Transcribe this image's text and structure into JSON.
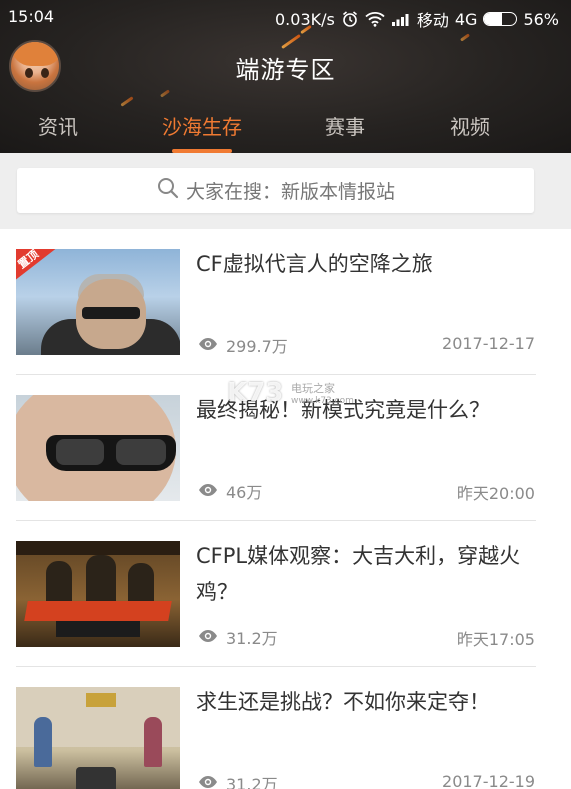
{
  "status_bar": {
    "time": "15:04",
    "speed": "0.03K/s",
    "carrier": "移动",
    "network": "4G",
    "battery_percent": "56%",
    "battery_level": 0.56,
    "icons": [
      "alarm-icon",
      "wifi-icon",
      "signal-icon",
      "battery-icon"
    ]
  },
  "header": {
    "title": "端游专区",
    "avatar": "avatar-icon",
    "background": "#262321"
  },
  "tabs": [
    {
      "label": "资讯",
      "active": false
    },
    {
      "label": "沙海生存",
      "active": true
    },
    {
      "label": "赛事",
      "active": false
    },
    {
      "label": "视频",
      "active": false
    }
  ],
  "search": {
    "icon": "search-icon",
    "placeholder": "大家在搜：新版本情报站"
  },
  "articles": [
    {
      "title": "CF虚拟代言人的空降之旅",
      "views": "299.7万",
      "date": "2017-12-17",
      "badge": "置顶"
    },
    {
      "title": "最终揭秘！新模式究竟是什么？",
      "views": "46万",
      "date": "昨天20:00"
    },
    {
      "title": "CFPL媒体观察：大吉大利，穿越火鸡？",
      "views": "31.2万",
      "date": "昨天17:05"
    },
    {
      "title": "求生还是挑战？不如你来定夺！",
      "views": "31.2万",
      "date": "2017-12-19"
    }
  ],
  "watermark": {
    "brand": "K73",
    "site": "电玩之家",
    "url": "www.k73.com"
  },
  "colors": {
    "accent": "#f07a32",
    "text": "#333333",
    "meta": "#8a8a8a",
    "badge": "#e23b2f"
  }
}
